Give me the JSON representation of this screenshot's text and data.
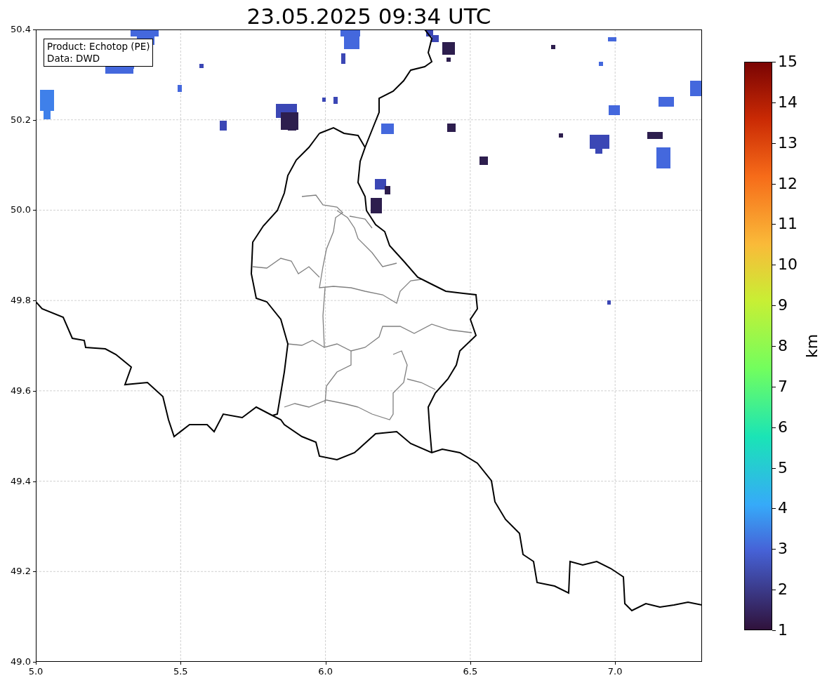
{
  "title": "23.05.2025 09:34 UTC",
  "legend_box": {
    "lines": [
      "Product: Echotop (PE)",
      "Data: DWD"
    ]
  },
  "x_axis": {
    "ticks": [
      "5.0",
      "5.5",
      "6.0",
      "6.5",
      "7.0"
    ]
  },
  "y_axis": {
    "ticks": [
      "50.4",
      "50.2",
      "50.0",
      "49.8",
      "49.6",
      "49.4",
      "49.2",
      "49.0"
    ]
  },
  "colorbar": {
    "label": "km",
    "ticks": [
      "15",
      "14",
      "13",
      "12",
      "11",
      "10",
      "9",
      "8",
      "7",
      "6",
      "5",
      "4",
      "3",
      "2",
      "1"
    ]
  }
}
